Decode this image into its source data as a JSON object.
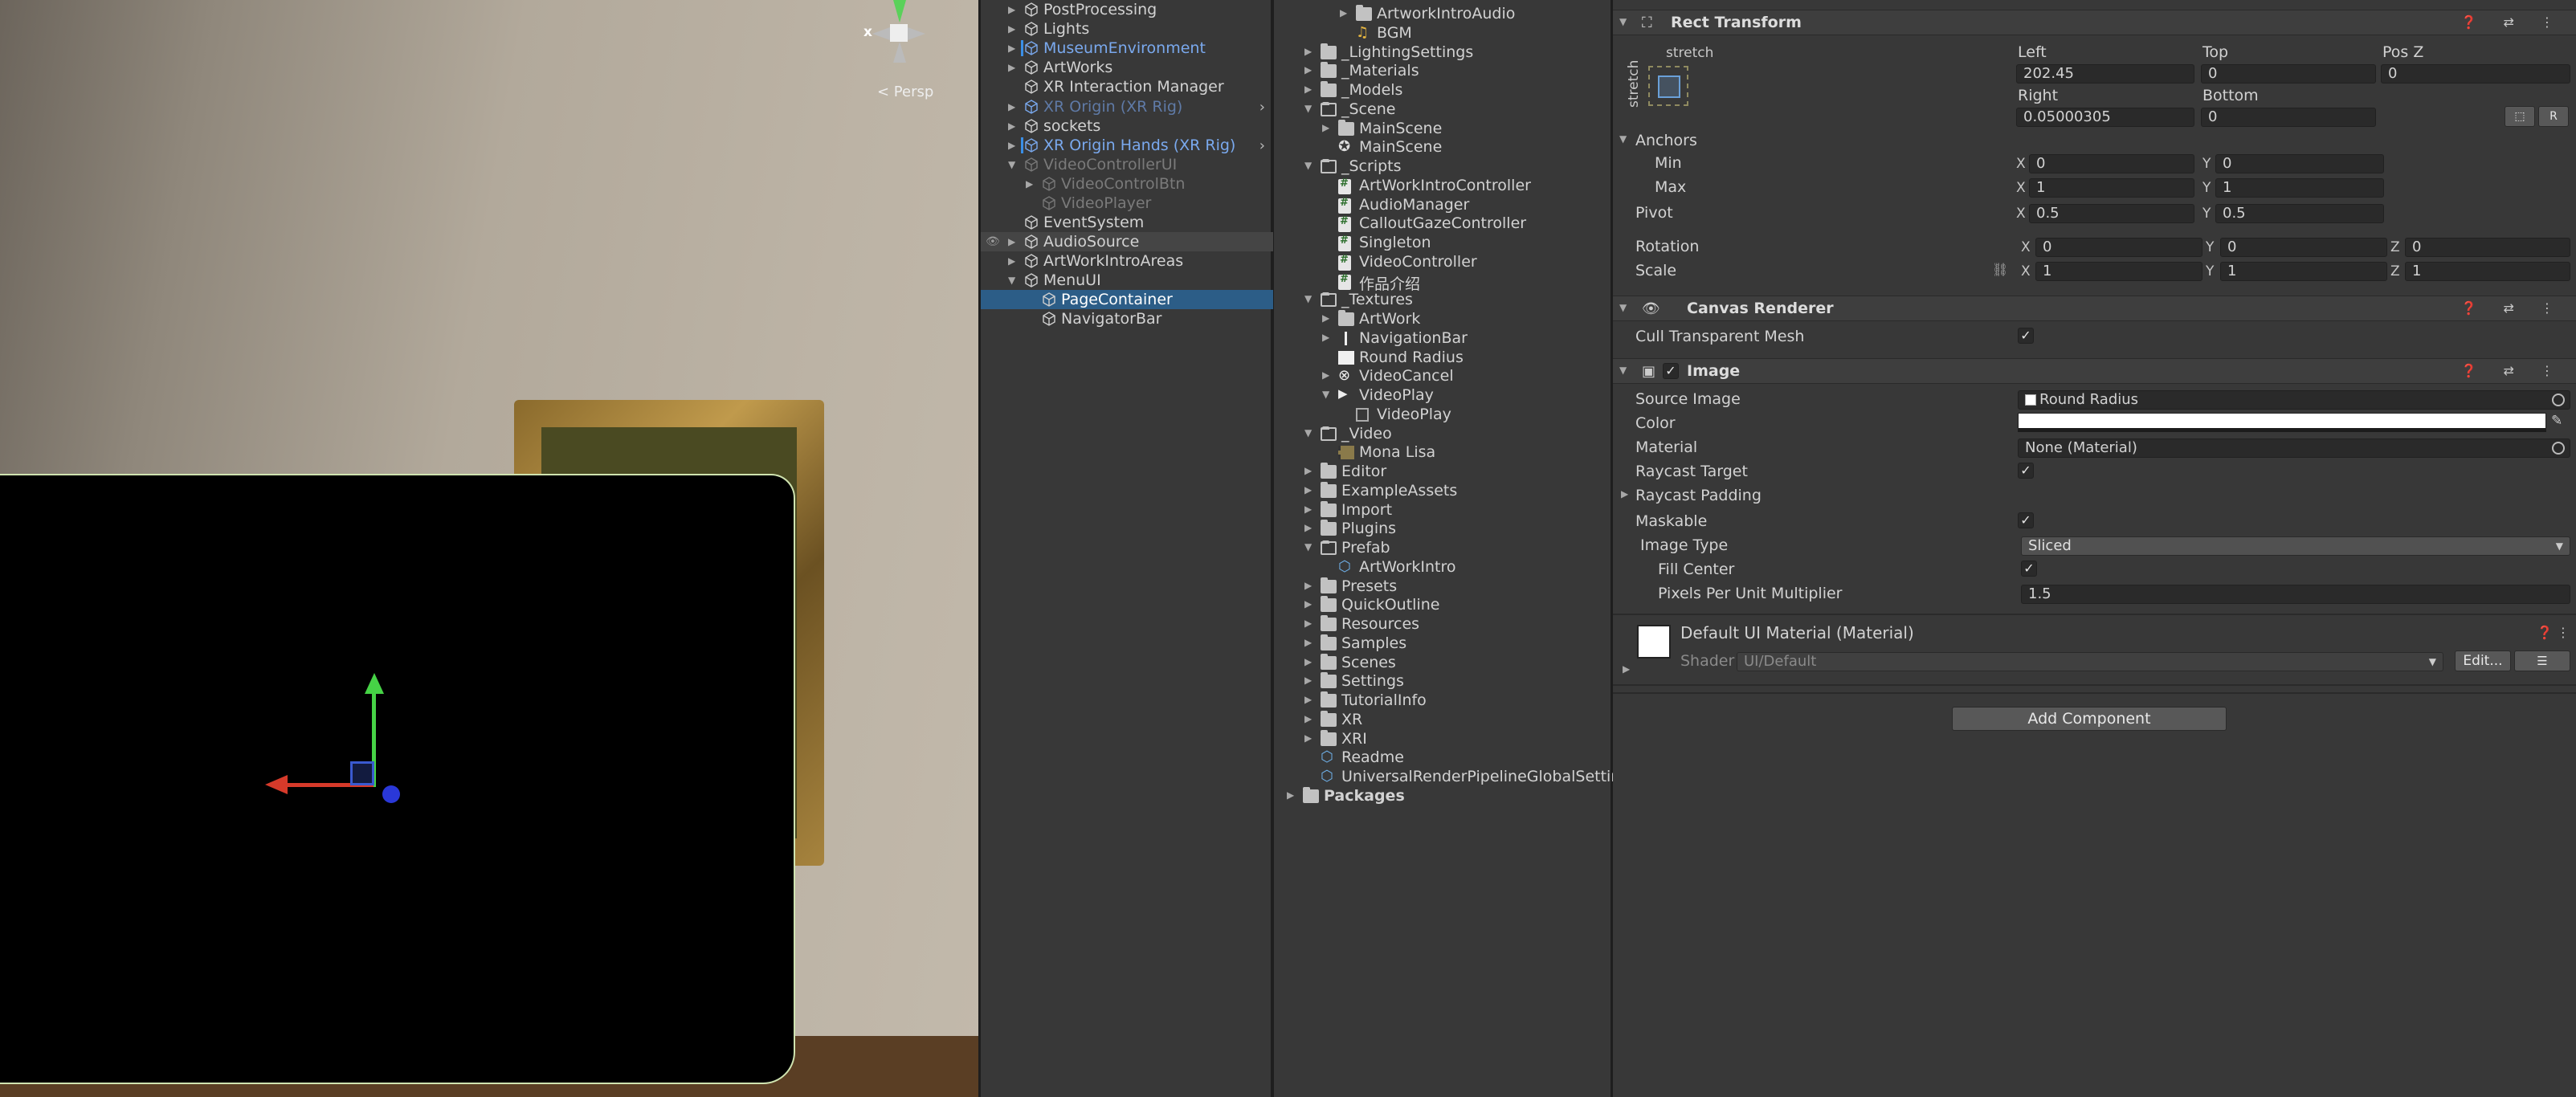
{
  "scene": {
    "orientation_axis": "x",
    "persp_label": "< Persp",
    "icons": [
      "orientation-gizmo-icon",
      "move-gizmo-icon"
    ]
  },
  "hierarchy": {
    "items": [
      {
        "label": "PostProcessing",
        "style": "normal",
        "arrow": "▶"
      },
      {
        "label": "Lights",
        "style": "normal",
        "arrow": "▶"
      },
      {
        "label": "MuseumEnvironment",
        "style": "blue",
        "arrow": "▶"
      },
      {
        "label": "ArtWorks",
        "style": "normal",
        "arrow": "▶"
      },
      {
        "label": "XR Interaction Manager",
        "style": "normal",
        "arrow": ""
      },
      {
        "label": "XR Origin (XR Rig)",
        "style": "dimblue",
        "arrow": "▶"
      },
      {
        "label": "sockets",
        "style": "normal",
        "arrow": "▶"
      },
      {
        "label": "XR Origin Hands (XR Rig)",
        "style": "blue",
        "arrow": "▶"
      },
      {
        "label": "VideoControllerUI",
        "style": "dim",
        "arrow": "▼"
      },
      {
        "label": "VideoControlBtn",
        "style": "dim",
        "arrow": "▶"
      },
      {
        "label": "VideoPlayer",
        "style": "dim",
        "arrow": ""
      },
      {
        "label": "EventSystem",
        "style": "normal",
        "arrow": ""
      },
      {
        "label": "AudioSource",
        "style": "normal",
        "arrow": "▶"
      },
      {
        "label": "ArtWorkIntroAreas",
        "style": "normal",
        "arrow": "▶"
      },
      {
        "label": "MenuUI",
        "style": "normal",
        "arrow": "▼"
      },
      {
        "label": "PageContainer",
        "style": "selected",
        "arrow": ""
      },
      {
        "label": "NavigatorBar",
        "style": "normal",
        "arrow": ""
      }
    ]
  },
  "project": {
    "items": [
      {
        "label": "ArtworkIntroAudio",
        "icon": "folder"
      },
      {
        "label": "BGM",
        "icon": "audio"
      },
      {
        "label": "_LightingSettings",
        "icon": "folder"
      },
      {
        "label": "_Materials",
        "icon": "folder"
      },
      {
        "label": "_Models",
        "icon": "folder"
      },
      {
        "label": "_Scene",
        "icon": "folder-open"
      },
      {
        "label": "MainScene",
        "icon": "folder"
      },
      {
        "label": "MainScene",
        "icon": "scene"
      },
      {
        "label": "_Scripts",
        "icon": "folder-open"
      },
      {
        "label": "ArtWorkIntroController",
        "icon": "script"
      },
      {
        "label": "AudioManager",
        "icon": "script"
      },
      {
        "label": "CalloutGazeController",
        "icon": "script"
      },
      {
        "label": "Singleton",
        "icon": "script"
      },
      {
        "label": "VideoController",
        "icon": "script"
      },
      {
        "label": "作品介绍",
        "icon": "script"
      },
      {
        "label": "_Textures",
        "icon": "folder-open"
      },
      {
        "label": "ArtWork",
        "icon": "folder"
      },
      {
        "label": "NavigationBar",
        "icon": "texture-thin"
      },
      {
        "label": "Round Radius",
        "icon": "texture"
      },
      {
        "label": "VideoCancel",
        "icon": "cancel"
      },
      {
        "label": "VideoPlay",
        "icon": "video"
      },
      {
        "label": "VideoPlay",
        "icon": "sprite"
      },
      {
        "label": "_Video",
        "icon": "folder-open"
      },
      {
        "label": "Mona Lisa",
        "icon": "movie"
      },
      {
        "label": "Editor",
        "icon": "folder"
      },
      {
        "label": "ExampleAssets",
        "icon": "folder"
      },
      {
        "label": "Import",
        "icon": "folder"
      },
      {
        "label": "Plugins",
        "icon": "folder"
      },
      {
        "label": "Prefab",
        "icon": "folder-open"
      },
      {
        "label": "ArtWorkIntro",
        "icon": "prefab"
      },
      {
        "label": "Presets",
        "icon": "folder"
      },
      {
        "label": "QuickOutline",
        "icon": "folder"
      },
      {
        "label": "Resources",
        "icon": "folder"
      },
      {
        "label": "Samples",
        "icon": "folder"
      },
      {
        "label": "Scenes",
        "icon": "folder"
      },
      {
        "label": "Settings",
        "icon": "folder"
      },
      {
        "label": "TutorialInfo",
        "icon": "folder"
      },
      {
        "label": "XR",
        "icon": "folder"
      },
      {
        "label": "XRI",
        "icon": "folder"
      },
      {
        "label": "Readme",
        "icon": "prefab"
      },
      {
        "label": "UniversalRenderPipelineGlobalSettings",
        "icon": "prefab"
      },
      {
        "label": "Packages",
        "icon": "folder"
      }
    ]
  },
  "inspector": {
    "rect_transform": {
      "title": "Rect Transform",
      "stretch_h": "stretch",
      "stretch_v": "stretch",
      "left_label": "Left",
      "left": "202.45",
      "top_label": "Top",
      "top": "0",
      "posz_label": "Pos Z",
      "posz": "0",
      "right_label": "Right",
      "right": "0.05000305",
      "bottom_label": "Bottom",
      "bottom": "0",
      "blueprint_btn": "⬚",
      "raw_btn": "R",
      "anchors_label": "Anchors",
      "min_label": "Min",
      "min_x": "0",
      "min_y": "0",
      "max_label": "Max",
      "max_x": "1",
      "max_y": "1",
      "pivot_label": "Pivot",
      "pivot_x": "0.5",
      "pivot_y": "0.5",
      "rotation_label": "Rotation",
      "rot_x": "0",
      "rot_y": "0",
      "rot_z": "0",
      "scale_label": "Scale",
      "scale_x": "1",
      "scale_y": "1",
      "scale_z": "1",
      "axis_x": "X",
      "axis_y": "Y",
      "axis_z": "Z"
    },
    "canvas_renderer": {
      "title": "Canvas Renderer",
      "cull_label": "Cull Transparent Mesh"
    },
    "image": {
      "title": "Image",
      "source_label": "Source Image",
      "source": "Round Radius",
      "color_label": "Color",
      "material_label": "Material",
      "material": "None (Material)",
      "raycast_target_label": "Raycast Target",
      "raycast_padding_label": "Raycast Padding",
      "maskable_label": "Maskable",
      "image_type_label": "Image Type",
      "image_type": "Sliced",
      "fill_center_label": "Fill Center",
      "ppu_label": "Pixels Per Unit Multiplier",
      "ppu": "1.5"
    },
    "material_section": {
      "title": "Default UI Material (Material)",
      "shader_label": "Shader",
      "shader": "UI/Default",
      "edit_btn": "Edit...",
      "list_btn": "☰"
    },
    "add_component": "Add Component",
    "header_icons": "❓ ⇄ ⋮"
  }
}
